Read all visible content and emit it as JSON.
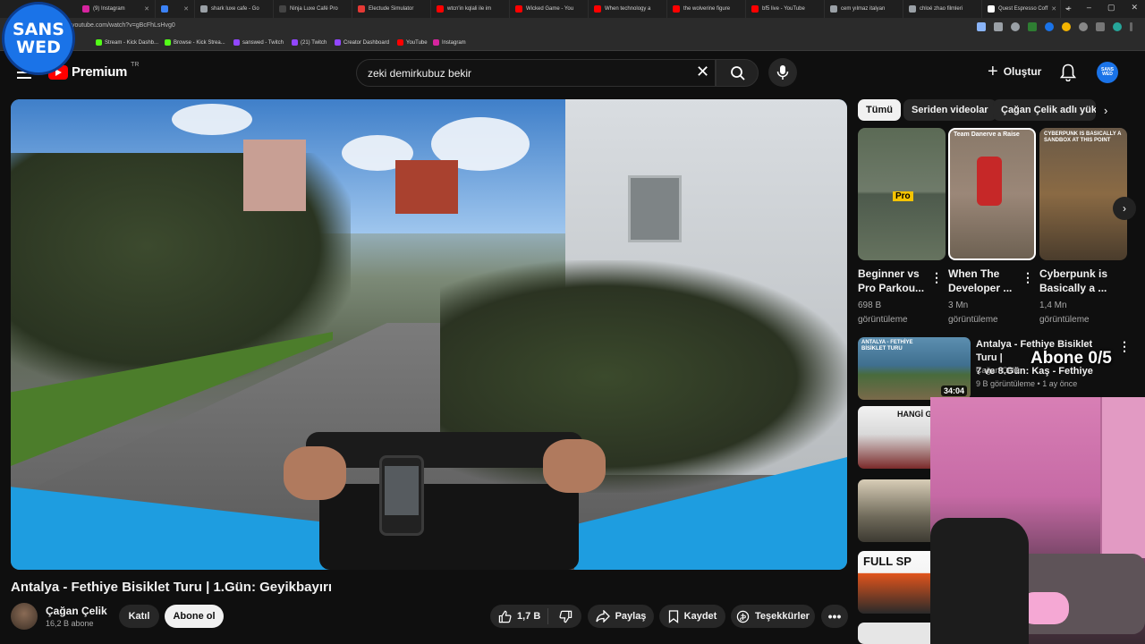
{
  "browser": {
    "tabs": [
      {
        "label": "(9) Instagram",
        "color": "#d6249f"
      },
      {
        "label": "",
        "color": "#3b82f6"
      },
      {
        "label": "shark luxe cafe - Go",
        "color": "#9aa0a6"
      },
      {
        "label": "Ninja Luxe Café Pro",
        "color": "#444444"
      },
      {
        "label": "Electude Simulator",
        "color": "#e53935"
      },
      {
        "label": "wtcn'in kqlali ile im",
        "color": "#ff0000"
      },
      {
        "label": "Wicked Game - You",
        "color": "#ff0000"
      },
      {
        "label": "When technology a",
        "color": "#ff0000"
      },
      {
        "label": "the wolverine figure",
        "color": "#ff0000"
      },
      {
        "label": "bf5 live - YouTube",
        "color": "#ff0000"
      },
      {
        "label": "cem yılmaz italyan",
        "color": "#9aa0a6"
      },
      {
        "label": "chloé zhao filmleri",
        "color": "#9aa0a6"
      },
      {
        "label": "Quest Espresso Coff",
        "color": "#ffffff"
      }
    ],
    "url": "youtube.com/watch?v=gBcFhLsHvg0",
    "bookmarks": [
      {
        "label": "Stream - Kick Dashb...",
        "color": "#53fc18"
      },
      {
        "label": "Browse - Kick Strea...",
        "color": "#53fc18"
      },
      {
        "label": "sanswed - Twitch",
        "color": "#9146ff"
      },
      {
        "label": "(21) Twitch",
        "color": "#9146ff"
      },
      {
        "label": "Creator Dashboard",
        "color": "#9146ff"
      },
      {
        "label": "YouTube",
        "color": "#ff0000"
      },
      {
        "label": "Instagram",
        "color": "#d6249f"
      }
    ]
  },
  "badge": {
    "line1": "SANS",
    "line2": "WED"
  },
  "header": {
    "logo_text": "Premium",
    "country_code": "TR",
    "search_value": "zeki demirkubuz bekir",
    "create_label": "Oluştur",
    "avatar_text": "SANS WED"
  },
  "video": {
    "title": "Antalya - Fethiye Bisiklet Turu | 1.Gün: Geyikbayırı",
    "channel_name": "Çağan Çelik",
    "subscribers": "16,2 B abone",
    "join_label": "Katıl",
    "subscribe_label": "Abone ol",
    "like_count": "1,7 B",
    "share_label": "Paylaş",
    "save_label": "Kaydet",
    "thanks_label": "Teşekkürler"
  },
  "sidebar": {
    "chips": [
      "Tümü",
      "Seriden videolar",
      "Çağan Çelik adlı yükle"
    ],
    "shorts": [
      {
        "title_line1": "Beginner vs",
        "title_line2": "Pro Parkou...",
        "views_line1": "698 B",
        "views_line2": "görüntüleme",
        "thumb_label": "Pro"
      },
      {
        "title_line1": "When The",
        "title_line2": "Developer ...",
        "views_line1": "3 Mn",
        "views_line2": "görüntüleme",
        "thumb_label": "Team Danerve a Raise"
      },
      {
        "title_line1": "Cyberpunk is",
        "title_line2": "Basically a ...",
        "views_line1": "1,4 Mn",
        "views_line2": "görüntüleme",
        "thumb_label": "CYBERPUNK IS BASICALLY A SANDBOX AT THIS POINT"
      }
    ],
    "recommended": {
      "title_line1": "Antalya - Fethiye Bisiklet Turu |",
      "title_line2": "7 ve 8.Gün: Kaş - Fethiye",
      "channel": "Çağan Çelik",
      "meta": "9 B görüntüleme • 1 ay önce",
      "duration": "34:04",
      "thumb_label": "ANTALYA - FETHİYE BİSİKLET TURU"
    },
    "more_thumbs": [
      {
        "label": "HANGİ GERÇEK"
      },
      {
        "label": ""
      },
      {
        "label": "FULL SP"
      }
    ]
  },
  "overlay": {
    "abone_text": "Abone 0/5"
  }
}
